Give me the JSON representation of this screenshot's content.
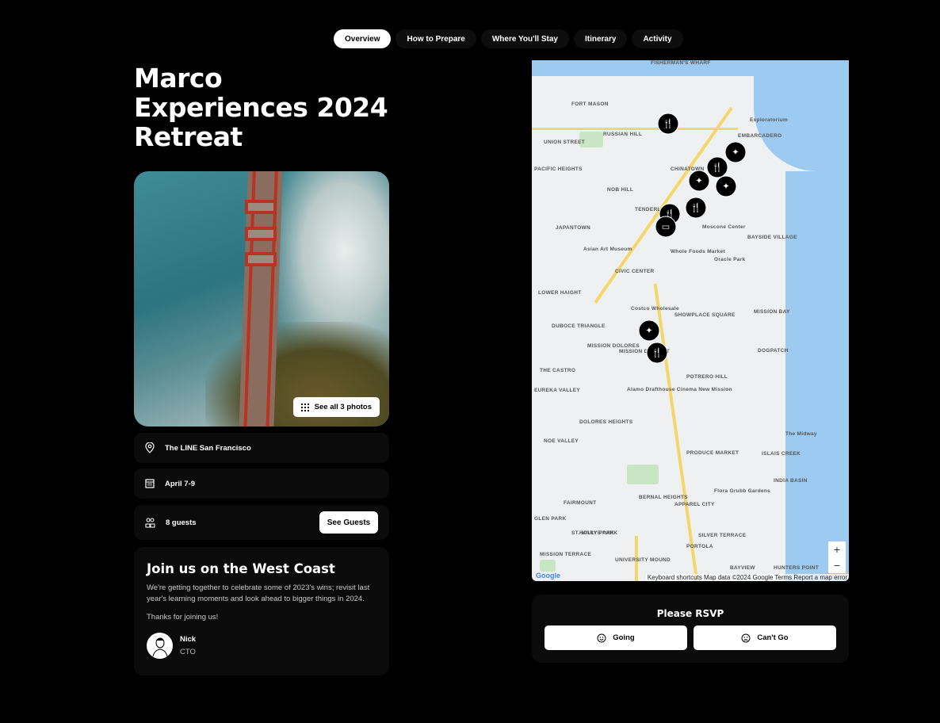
{
  "tabs": [
    {
      "label": "Overview",
      "active": true
    },
    {
      "label": "How to Prepare"
    },
    {
      "label": "Where You'll Stay"
    },
    {
      "label": "Itinerary"
    },
    {
      "label": "Activity"
    }
  ],
  "title": "Marco Experiences 2024 Retreat",
  "photo": {
    "see_all_label": "See all 3 photos",
    "icon": "grid-icon"
  },
  "details": {
    "location": "The LINE San Francisco",
    "dates": "April 7-9",
    "guests": "8 guests",
    "see_guests_label": "See Guests"
  },
  "message": {
    "heading": "Join us on the West Coast",
    "body": "We're getting together to celebrate some of 2023's wins; revisit last year's learning moments and look ahead to bigger things in 2024.",
    "thanks": "Thanks for joining us!",
    "author_name": "Nick",
    "author_role": "CTO"
  },
  "map": {
    "labels": [
      "FISHERMAN'S WHARF",
      "FORT MASON",
      "RUSSIAN HILL",
      "UNION STREET",
      "EMBARCADERO",
      "CHINATOWN",
      "NOB HILL",
      "TENDERLOIN",
      "JAPANTOWN",
      "CIVIC CENTER",
      "LOWER HAIGHT",
      "DUBOCE TRIANGLE",
      "MISSION DOLORES",
      "MISSION DISTRICT",
      "THE CASTRO",
      "SHOWPLACE SQUARE",
      "POTRERO HILL",
      "MISSION BAY",
      "DOGPATCH",
      "NOE VALLEY",
      "DOLORES HEIGHTS",
      "BERNAL HEIGHTS",
      "PRODUCE MARKET",
      "ISLAIS CREEK",
      "INDIA BASIN",
      "GLEN PARK",
      "FAIRMOUNT",
      "HOLLY PARK",
      "ST. MARYS PARK",
      "PORTOLA",
      "SILVER TERRACE",
      "UNIVERSITY MOUND",
      "MISSION TERRACE",
      "BAYVIEW",
      "HUNTERS POINT",
      "BAYSIDE VILLAGE",
      "APPAREL CITY",
      "EUREKA VALLEY",
      "PACIFIC HEIGHTS",
      "Moscone Center",
      "Oracle Park",
      "Whole Foods Market",
      "Costco Wholesale",
      "Asian Art Museum",
      "Exploratorium",
      "Alamo Drafthouse Cinema New Mission",
      "The Midway",
      "Flora Grubb Gardens"
    ],
    "markers": [
      "restaurant-icon",
      "sparkle-icon",
      "restaurant-icon",
      "sparkle-icon",
      "sparkle-icon",
      "restaurant-icon",
      "restaurant-icon",
      "bed-icon",
      "sparkle-icon",
      "restaurant-icon"
    ],
    "attribution": "Keyboard shortcuts   Map data ©2024 Google   Terms   Report a map error",
    "logo": "Google",
    "zoom_in": "+",
    "zoom_out": "−"
  },
  "rsvp": {
    "title": "Please RSVP",
    "going_label": "Going",
    "cant_go_label": "Can't Go"
  }
}
